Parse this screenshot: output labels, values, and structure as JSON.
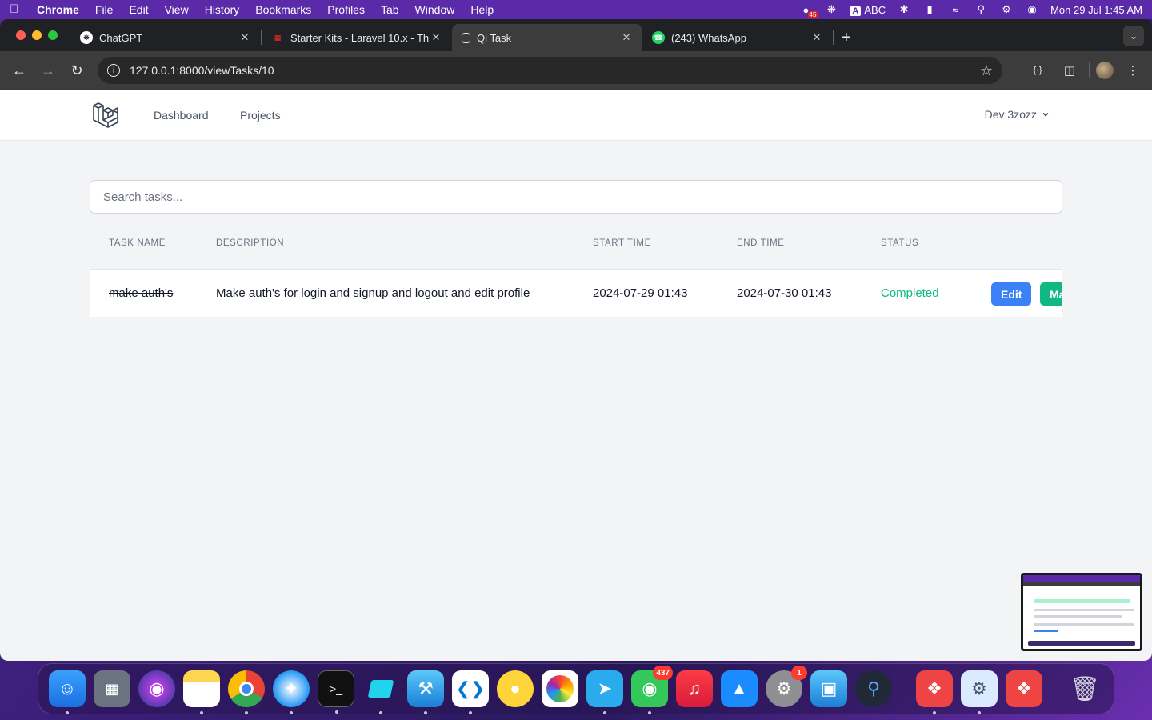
{
  "menubar": {
    "app_name": "Chrome",
    "items": [
      "File",
      "Edit",
      "View",
      "History",
      "Bookmarks",
      "Profiles",
      "Tab",
      "Window",
      "Help"
    ],
    "input_source": "ABC",
    "rec_count": "45",
    "datetime": "Mon 29 Jul  1:45 AM"
  },
  "browser": {
    "tabs": [
      {
        "title": "ChatGPT",
        "icon": "chatgpt-icon"
      },
      {
        "title": "Starter Kits - Laravel 10.x - Th",
        "icon": "laravel-icon"
      },
      {
        "title": "Qi Task",
        "icon": "qitask-icon"
      },
      {
        "title": "(243) WhatsApp",
        "icon": "whatsapp-icon"
      }
    ],
    "url": "127.0.0.1:8000/viewTasks/10"
  },
  "app": {
    "nav": {
      "dashboard": "Dashboard",
      "projects": "Projects",
      "user": "Dev 3zozz"
    },
    "search": {
      "placeholder": "Search tasks..."
    },
    "table": {
      "headers": {
        "name": "TASK NAME",
        "description": "DESCRIPTION",
        "start": "START TIME",
        "end": "END TIME",
        "status": "STATUS"
      },
      "rows": [
        {
          "name": "make auth's",
          "description": "Make auth's for login and signup and logout and edit profile",
          "start": "2024-07-29 01:43",
          "end": "2024-07-30 01:43",
          "status": "Completed",
          "edit_label": "Edit",
          "mark_label": "Ma"
        }
      ]
    }
  },
  "dock": {
    "messages_badge": "437",
    "settings_badge": "1"
  },
  "colors": {
    "accent_blue": "#3b82f6",
    "status_green": "#10b981"
  }
}
